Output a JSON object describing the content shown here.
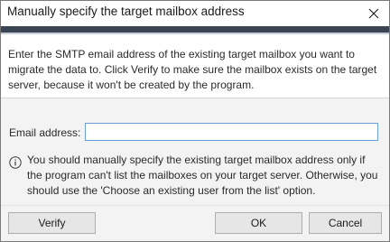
{
  "window": {
    "title": "Manually specify the target mailbox address"
  },
  "header": {
    "description": "Enter the SMTP email address of the existing target mailbox you want to migrate the data to. Click Verify to make sure the mailbox exists on the target server, because it won't be created by the program."
  },
  "form": {
    "email_label": "Email address:",
    "email_value": ""
  },
  "info": {
    "text": "You should manually specify the existing target mailbox address only if the program can't list the mailboxes on your target server. Otherwise, you should use the 'Choose an existing user from the list' option."
  },
  "footer": {
    "verify_label": "Verify",
    "ok_label": "OK",
    "cancel_label": "Cancel"
  },
  "colors": {
    "accent_bar": "#3a4452",
    "input_border": "#6aa0d8",
    "panel_bg": "#f3f3f3"
  },
  "icons": {
    "close": "close-icon",
    "info": "info-icon"
  }
}
